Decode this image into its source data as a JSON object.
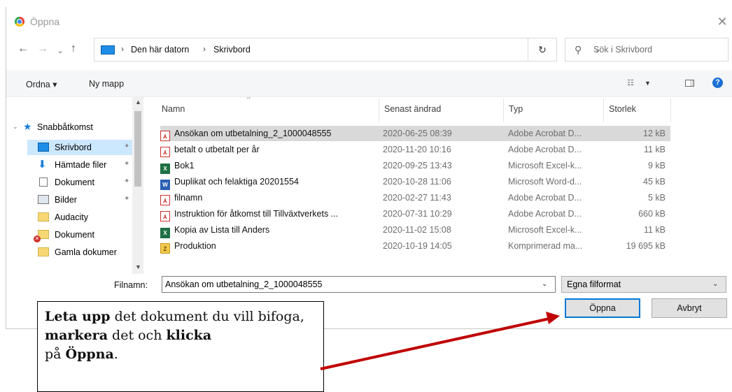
{
  "window": {
    "title": "Öppna",
    "close_glyph": "✕"
  },
  "address": {
    "crumbs": [
      "Den här datorn",
      "Skrivbord"
    ],
    "search_placeholder": "Sök i Skrivbord"
  },
  "toolbar": {
    "organize": "Ordna ▾",
    "new_folder": "Ny mapp",
    "help": "?"
  },
  "nav": {
    "items": [
      {
        "label": "Snabbåtkomst",
        "icon": "star-icon"
      },
      {
        "label": "Skrivbord",
        "icon": "desktop-icon",
        "pinned": true
      },
      {
        "label": "Hämtade filer",
        "icon": "download-icon",
        "pinned": true
      },
      {
        "label": "Dokument",
        "icon": "documents-icon",
        "pinned": true
      },
      {
        "label": "Bilder",
        "icon": "pictures-icon",
        "pinned": true
      },
      {
        "label": "Audacity",
        "icon": "folder-icon"
      },
      {
        "label": "Dokument",
        "icon": "folder-icon"
      },
      {
        "label": "Gamla dokumer",
        "icon": "folder-icon"
      }
    ]
  },
  "columns": {
    "name": "Namn",
    "date": "Senast ändrad",
    "type": "Typ",
    "size": "Storlek"
  },
  "files": [
    {
      "name": "Ansökan om utbetalning_2_1000048555",
      "date": "2020-06-25 08:39",
      "type": "Adobe Acrobat D...",
      "size": "12 kB",
      "kind": "pdf"
    },
    {
      "name": "betalt o utbetalt per år",
      "date": "2020-11-20 10:16",
      "type": "Adobe Acrobat D...",
      "size": "11 kB",
      "kind": "pdf"
    },
    {
      "name": "Bok1",
      "date": "2020-09-25 13:43",
      "type": "Microsoft Excel-k...",
      "size": "9 kB",
      "kind": "xls"
    },
    {
      "name": "Duplikat och felaktiga 20201554",
      "date": "2020-10-28 11:06",
      "type": "Microsoft Word-d...",
      "size": "45 kB",
      "kind": "doc"
    },
    {
      "name": "filnamn",
      "date": "2020-02-27 11:43",
      "type": "Adobe Acrobat D...",
      "size": "5 kB",
      "kind": "pdf"
    },
    {
      "name": "Instruktion för åtkomst till Tillväxtverkets ...",
      "date": "2020-07-31 10:29",
      "type": "Adobe Acrobat D...",
      "size": "660 kB",
      "kind": "pdf"
    },
    {
      "name": "Kopia av Lista till Anders",
      "date": "2020-11-02 15:08",
      "type": "Microsoft Excel-k...",
      "size": "11 kB",
      "kind": "xls"
    },
    {
      "name": "Produktion",
      "date": "2020-10-19 14:05",
      "type": "Komprimerad ma...",
      "size": "19 695 kB",
      "kind": "zip"
    }
  ],
  "filename": {
    "label": "Filnamn:",
    "value": "Ansökan om utbetalning_2_1000048555"
  },
  "filetype": {
    "value": "Egna filformat"
  },
  "buttons": {
    "open": "Öppna",
    "cancel": "Avbryt"
  },
  "callout": {
    "b1": "Leta upp",
    "t1": " det dokument du vill bifoga, ",
    "b2": "markera",
    "t2": " det och ",
    "b3": "klicka",
    "t3": " på ",
    "b4": "Öppna",
    "t4": "."
  },
  "colors": {
    "selection": "#cce8ff",
    "row_selected": "#d9d9d9",
    "primary_border": "#0078d7",
    "arrow": "#c00000"
  }
}
